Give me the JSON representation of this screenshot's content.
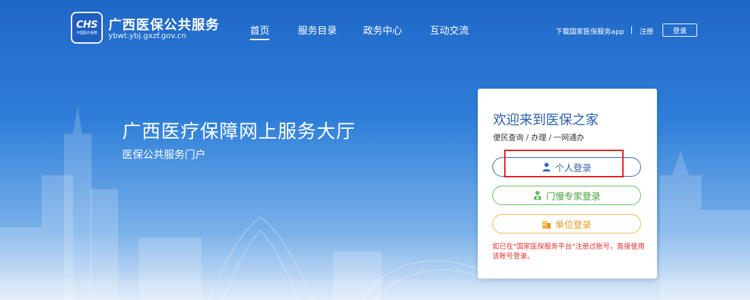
{
  "header": {
    "logo_text": "CHS",
    "logo_sub": "中国医疗保障",
    "site_name": "广西医保公共服务",
    "site_domain": "ybwt.ybj.gxzf.gov.cn",
    "nav": [
      {
        "label": "首页",
        "active": true
      },
      {
        "label": "服务目录",
        "active": false
      },
      {
        "label": "政务中心",
        "active": false
      },
      {
        "label": "互动交流",
        "active": false
      }
    ],
    "download_label": "下载国家医保服务app",
    "register_label": "注册",
    "login_label": "登录"
  },
  "hero": {
    "title": "广西医疗保障网上服务大厅",
    "subtitle": "医保公共服务门户"
  },
  "card": {
    "title": "欢迎来到医保之家",
    "subtitle": "便民查询 / 办理 / 一网通办",
    "personal_login": "个人登录",
    "expert_login": "门慢专家登录",
    "unit_login": "单位登录",
    "note": "如已在\"国家医保服务平台\"注册过账号，直接使用该账号登录。"
  },
  "colors": {
    "primary": "#2f63b3",
    "expert": "#5fbd5a",
    "unit": "#f0b44a",
    "note": "#e0322c",
    "highlight": "#e8191a"
  },
  "icons": {
    "personal": "person-icon",
    "expert": "doctor-icon",
    "unit": "building-icon"
  }
}
